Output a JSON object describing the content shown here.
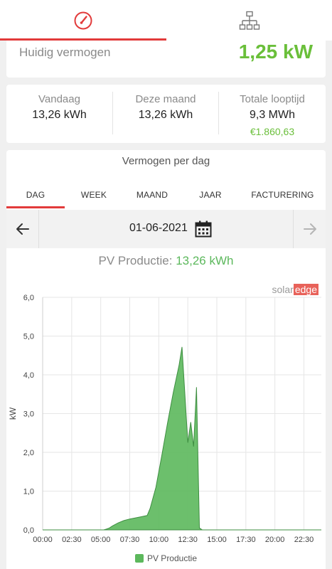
{
  "nav": {
    "tabs": [
      {
        "icon": "dashboard-gauge-icon",
        "active": true
      },
      {
        "icon": "site-layout-icon",
        "active": false
      }
    ],
    "accent": "#e23b3b"
  },
  "power": {
    "label": "Huidig vermogen",
    "value": "1,25 kW"
  },
  "stats": {
    "today_label": "Vandaag",
    "today_value": "13,26 kWh",
    "month_label": "Deze maand",
    "month_value": "13,26 kWh",
    "lifetime_label": "Totale looptijd",
    "lifetime_value": "9,3 MWh",
    "lifetime_money": "€1.860,63"
  },
  "chart_card": {
    "title": "Vermogen per dag",
    "tabs": [
      "DAG",
      "WEEK",
      "MAAND",
      "JAAR",
      "FACTURERING"
    ],
    "active_tab": "DAG",
    "date": "01-06-2021",
    "pv_label": "PV Productie: ",
    "pv_value": "13,26 kWh",
    "brand_a": "solar",
    "brand_b": "edge",
    "legend": "PV Productie"
  },
  "chart_data": {
    "type": "area",
    "ylabel": "kW",
    "ylim": [
      0,
      6
    ],
    "yticks": [
      "0,0",
      "1,0",
      "2,0",
      "3,0",
      "4,0",
      "5,0",
      "6,0"
    ],
    "xticks": [
      "00:00",
      "02:30",
      "05:00",
      "07:30",
      "10:00",
      "12:30",
      "15:00",
      "17:30",
      "20:00",
      "22:30"
    ],
    "xlim_hours": [
      0,
      24
    ],
    "grid": true,
    "series": [
      {
        "name": "PV Productie",
        "color": "#5cb85c",
        "points": [
          [
            0,
            0
          ],
          [
            5.25,
            0
          ],
          [
            5.5,
            0.02
          ],
          [
            5.75,
            0.05
          ],
          [
            6.0,
            0.1
          ],
          [
            6.5,
            0.18
          ],
          [
            7.0,
            0.24
          ],
          [
            7.5,
            0.28
          ],
          [
            8.0,
            0.31
          ],
          [
            8.5,
            0.34
          ],
          [
            9.0,
            0.37
          ],
          [
            9.25,
            0.55
          ],
          [
            9.75,
            1.1
          ],
          [
            10.25,
            1.9
          ],
          [
            10.75,
            2.75
          ],
          [
            11.25,
            3.55
          ],
          [
            11.75,
            4.25
          ],
          [
            12.0,
            4.72
          ],
          [
            12.5,
            2.25
          ],
          [
            12.75,
            2.78
          ],
          [
            13.0,
            2.15
          ],
          [
            13.25,
            3.68
          ],
          [
            13.5,
            0.05
          ],
          [
            13.75,
            0
          ],
          [
            24,
            0
          ]
        ]
      }
    ]
  }
}
